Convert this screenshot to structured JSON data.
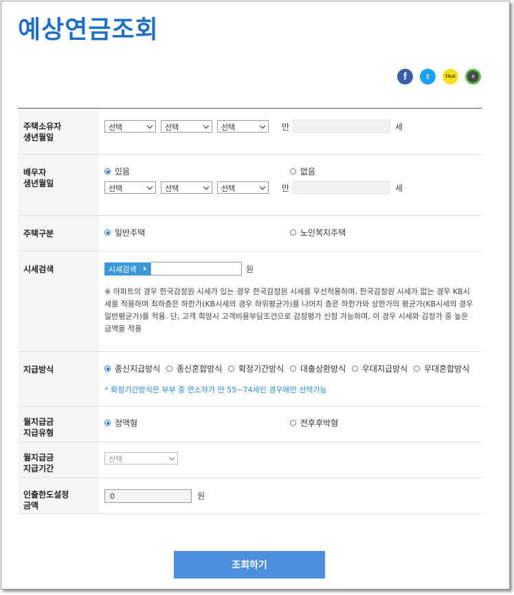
{
  "title": "예상연금조회",
  "share": [
    {
      "name": "facebook-icon",
      "glyph": "f"
    },
    {
      "name": "twitter-icon",
      "glyph": "t"
    },
    {
      "name": "kakaotalk-icon",
      "glyph": "TALK"
    },
    {
      "name": "kakaostory-icon",
      "glyph": "S"
    }
  ],
  "owner": {
    "label": "주택소유자\n생년월일",
    "year": "선택",
    "month": "선택",
    "day": "선택",
    "age_prefix": "만",
    "age_suffix": "세"
  },
  "spouse": {
    "label": "배우자\n생년월일",
    "yes": "있음",
    "no": "없음",
    "year": "선택",
    "month": "선택",
    "day": "선택",
    "age_prefix": "만",
    "age_suffix": "세"
  },
  "house_type": {
    "label": "주택구분",
    "opt1": "일반주택",
    "opt2": "노인복지주택"
  },
  "price": {
    "label": "시세검색",
    "button": "시세검색",
    "unit": "원",
    "note": "※ 아파트의 경우 한국감정원 시세가 있는 경우 한국감정원 시세를 우선적용하며, 한국감정원 시세가 없는 경우 KB시세를 적용하며 최하층은 하한가(KB시세의 경우 하위평균가)를 나머지 층은 하한가와 상한가의 평균가(KB시세의 경우 일반평균가)를 적용. 단, 고객 희망시 고객비용부담조건으로 감정평가 신청 가능하며, 이 경우 시세와 감정가 중 높은 금액을 적용"
  },
  "payment": {
    "label": "지급방식",
    "options": [
      "종신지급방식",
      "종신혼합방식",
      "확정기간방식",
      "대출상환방식",
      "우대지급방식",
      "우대혼합방식"
    ],
    "note": "* 확정기간방식은 부부 중 연소자가 만 55~74세인 경우에만 선택가능"
  },
  "monthly_type": {
    "label": "월지급금\n지급유형",
    "opt1": "정액형",
    "opt2": "전후후박형"
  },
  "monthly_period": {
    "label": "월지급금\n지급기간",
    "select": "선택"
  },
  "withdraw": {
    "label": "인출한도설정\n금액",
    "value": "0",
    "unit": "원"
  },
  "submit": "조회하기"
}
